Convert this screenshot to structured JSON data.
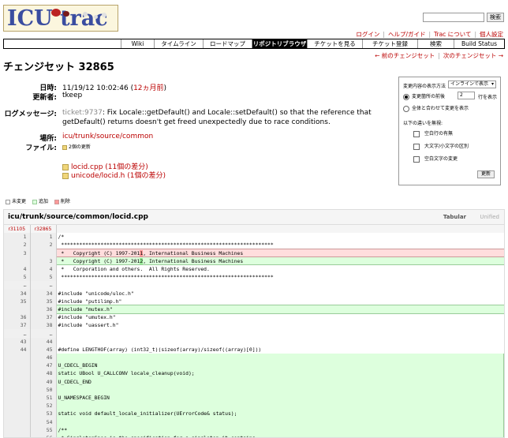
{
  "logo": {
    "text": "ICU trac"
  },
  "search": {
    "button_label": "検索"
  },
  "metanav": [
    "ログイン",
    "ヘルプ/ガイド",
    "Trac について",
    "個人設定"
  ],
  "mainnav": [
    {
      "label": "Wiki",
      "active": false
    },
    {
      "label": "タイムライン",
      "active": false
    },
    {
      "label": "ロードマップ",
      "active": false
    },
    {
      "label": "リポジトリブラウザ",
      "active": true
    },
    {
      "label": "チケットを見る",
      "active": false
    },
    {
      "label": "チケット登録",
      "active": false
    },
    {
      "label": "検索",
      "active": false
    },
    {
      "label": "Build Status",
      "active": false
    }
  ],
  "ctxnav": {
    "prev": "← 前のチェンジセット",
    "next": "次のチェンジセット →"
  },
  "changeset": {
    "title": "チェンジセット 32865",
    "date_label": "日時:",
    "date_value": "11/19/12 10:02:46 (",
    "date_rel": "12ヵ月前",
    "date_close": ")",
    "author_label": "更新者:",
    "author_value": "tkeep",
    "message_label": "ログメッセージ:",
    "ticket_ref": "ticket:9737",
    "message_line1": ": Fix Locale::getDefault() and Locale::setDefault() so that the reference that",
    "message_line2": "getDefault() returns doesn't get freed unexpectedly due to race conditions.",
    "location_label": "場所:",
    "location_value": "icu/trunk/source/common",
    "files_label": "ファイル:",
    "files_summary": "2個の更新",
    "files": [
      {
        "name": "locid.cpp",
        "diffs": "(11個の差分)"
      },
      {
        "name": "unicode/locid.h",
        "diffs": "(1個の差分)"
      }
    ]
  },
  "options": {
    "label_show": "変更内容の表示方法",
    "select_value": "インラインで表示",
    "radio1": "変更箇所の前後",
    "radio1_num": "2",
    "radio1_suffix": "行を表示",
    "radio2": "全体と合わせて変更を表示",
    "ignore_label": "以下の違いを無視:",
    "check1": "空白行の有無",
    "check2": "大文字/小文字の区別",
    "check3": "空白文字の変更",
    "update_button": "更新"
  },
  "legend": {
    "unchanged": "未変更",
    "added": "追加",
    "removed": "削除"
  },
  "diff": {
    "path": "icu/trunk/source/common/locid.cpp",
    "tabular": "Tabular",
    "unified": "Unified",
    "old_rev": "r31105",
    "new_rev": "r32865",
    "rows": [
      {
        "type": "ctx",
        "old": "1",
        "new": "1",
        "text": "/*"
      },
      {
        "type": "ctx",
        "old": "2",
        "new": "2",
        "text": " **********************************************************************"
      },
      {
        "type": "rem",
        "old": "3",
        "new": "",
        "pre": " *   Copyright (C) 1997-201",
        "hl": "1",
        "post": ", International Business Machines"
      },
      {
        "type": "add",
        "old": "",
        "new": "3",
        "pre": " *   Copyright (C) 1997-201",
        "hl": "2",
        "post": ", International Business Machines"
      },
      {
        "type": "ctx",
        "old": "4",
        "new": "4",
        "text": " *   Corporation and others.  All Rights Reserved."
      },
      {
        "type": "ctx",
        "old": "5",
        "new": "5",
        "text": " **********************************************************************"
      },
      {
        "type": "skip",
        "old": "…",
        "new": "…",
        "text": ""
      },
      {
        "type": "ctx",
        "old": "34",
        "new": "34",
        "text": "#include \"unicode/uloc.h\""
      },
      {
        "type": "ctx",
        "old": "35",
        "new": "35",
        "text": "#include \"putilimp.h\""
      },
      {
        "type": "add",
        "old": "",
        "new": "36",
        "text": "#include \"mutex.h\""
      },
      {
        "type": "ctx",
        "old": "36",
        "new": "37",
        "text": "#include \"umutex.h\""
      },
      {
        "type": "ctx",
        "old": "37",
        "new": "38",
        "text": "#include \"uassert.h\""
      },
      {
        "type": "skip",
        "old": "…",
        "new": "…",
        "text": ""
      },
      {
        "type": "ctx",
        "old": "43",
        "new": "44",
        "text": ""
      },
      {
        "type": "ctx",
        "old": "44",
        "new": "45",
        "text": "#define LENGTHOF(array) (int32_t)(sizeof(array)/sizeof((array)[0]))"
      },
      {
        "type": "addb",
        "old": "",
        "new": "46",
        "text": ""
      },
      {
        "type": "addb",
        "old": "",
        "new": "47",
        "text": "U_CDECL_BEGIN"
      },
      {
        "type": "addb",
        "old": "",
        "new": "48",
        "text": "static UBool U_CALLCONV locale_cleanup(void);"
      },
      {
        "type": "addb",
        "old": "",
        "new": "49",
        "text": "U_CDECL_END"
      },
      {
        "type": "addb",
        "old": "",
        "new": "50",
        "text": ""
      },
      {
        "type": "addb",
        "old": "",
        "new": "51",
        "text": "U_NAMESPACE_BEGIN"
      },
      {
        "type": "addb",
        "old": "",
        "new": "52",
        "text": ""
      },
      {
        "type": "addb",
        "old": "",
        "new": "53",
        "text": "static void default_locale_initializer(UErrorCode& status);"
      },
      {
        "type": "addb",
        "old": "",
        "new": "54",
        "text": ""
      },
      {
        "type": "addb",
        "old": "",
        "new": "55",
        "text": "/**"
      },
      {
        "type": "addb",
        "old": "",
        "new": "56",
        "text": " * SingletonSpec is the specification for a singleton it contains"
      }
    ]
  }
}
